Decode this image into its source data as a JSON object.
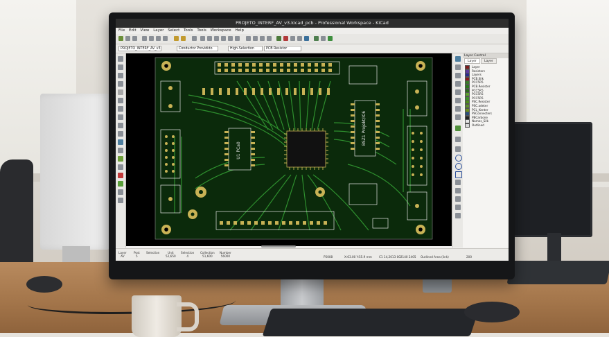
{
  "window": {
    "title": "PROJETO_INTERF_AV_v3.kicad_pcb - Professional Workspace - KiCad"
  },
  "menu": [
    "File",
    "Edit",
    "View",
    "Layer",
    "Select",
    "Tools",
    "Tools",
    "Workspace",
    "Help"
  ],
  "selectbar": {
    "project": "PROJETO_INTERF_AV_v3",
    "layer": "Conductor Providido",
    "selection": "High-Selection",
    "resistor": "PCB Resistor"
  },
  "layers_panel": {
    "header": "Layer Control",
    "tabs": [
      "Layer",
      "Layer"
    ],
    "layers": [
      {
        "name": "Layer",
        "color": "#7f1d1d"
      },
      {
        "name": "Resistors",
        "color": "#5e3b9d"
      },
      {
        "name": "Layers",
        "color": "#2b2b8f"
      },
      {
        "name": "PCB.Silk",
        "color": "#8b1a1a"
      },
      {
        "name": "PCC5R5",
        "color": "#3a7a2a"
      },
      {
        "name": "PCB.Resister",
        "color": "#2a7a1a"
      },
      {
        "name": "PCC5R5",
        "color": "#2a6a1a"
      },
      {
        "name": "PCC5R5",
        "color": "#5ba02d"
      },
      {
        "name": "PCC5R5",
        "color": "#3e8f2a"
      },
      {
        "name": "PSC.Resister",
        "color": "#4e8c1a"
      },
      {
        "name": "PSC.adeter",
        "color": "#5f8f2a"
      },
      {
        "name": "PCL_Kenter",
        "color": "#6b8f1e"
      },
      {
        "name": "PSConnecters",
        "color": "#2b4f7a"
      },
      {
        "name": "PBCarbone",
        "color": "#222222"
      },
      {
        "name": "Names_Silk",
        "color": "#e7e7e7"
      },
      {
        "name": "Outlined",
        "color": "#d8d8d8"
      }
    ]
  },
  "status": {
    "cells": [
      {
        "label": "Layer",
        "value": "AV"
      },
      {
        "label": "Post",
        "value": "5"
      },
      {
        "label": "Selection",
        "value": ""
      },
      {
        "label": "Unit",
        "value": "52,650"
      },
      {
        "label": "Selection",
        "value": "4"
      },
      {
        "label": "Collection",
        "value": "51,600"
      },
      {
        "label": "Number",
        "value": "56000"
      }
    ],
    "right": [
      "P5008",
      "X:63.00 Y:55.9 mm",
      "C1 14,2013 002140 2405",
      "Outlined Area (link)",
      "200"
    ]
  },
  "pcb_text": {
    "ic_left": "U1 PCa0",
    "ic_right": "BSZ1 Projekt/IC6"
  },
  "colors": {
    "canvas": "#000000",
    "board": "#0c2d0c",
    "trace": "#2e8f2e",
    "pad": "#c8b255",
    "silk": "#e8e8e8"
  }
}
